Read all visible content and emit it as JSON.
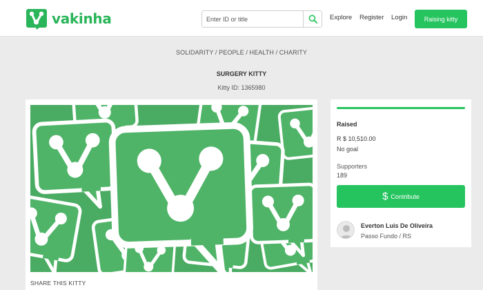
{
  "header": {
    "logo_text": "vakinha",
    "search": {
      "placeholder": "Enter ID or title",
      "value": ""
    },
    "nav": {
      "explore": "Explore",
      "register": "Register",
      "login": "Login"
    },
    "cta": "Raising kitty"
  },
  "page": {
    "breadcrumb": "SOLIDARITY / PEOPLE / HEALTH / CHARITY",
    "title": "SURGERY KITTY",
    "kitty_id": "Kitty ID: 1365980"
  },
  "main_card": {
    "share_label": "SHARE THIS KITTY"
  },
  "sidebar": {
    "progress": 1.0,
    "raised_label": "Raised",
    "raised_amount": "R $ 10,510.00",
    "goal": "No goal",
    "supporters_label": "Supporters",
    "supporters_count": "189",
    "contribute_icon": "$",
    "contribute_label": "Contribute",
    "organizer_name": "Everton Luis De Oliveira",
    "organizer_location": "Passo Fundo / RS"
  },
  "colors": {
    "brand_green": "#26c45f",
    "banner_green": "#4cae64",
    "page_bg": "#ebebeb"
  },
  "icons": {
    "logo": "vakinha-v-bubble-icon",
    "search": "search-icon",
    "contribute": "dollar-icon",
    "avatar": "user-avatar-icon"
  }
}
